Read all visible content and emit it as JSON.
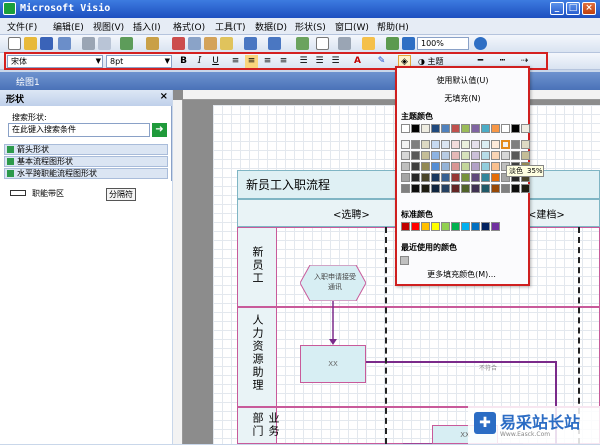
{
  "window": {
    "title": "Microsoft Visio"
  },
  "menu": [
    "文件(F)",
    "编辑(E)",
    "视图(V)",
    "插入(I)",
    "格式(O)",
    "工具(T)",
    "数据(D)",
    "形状(S)",
    "窗口(W)",
    "帮助(H)"
  ],
  "toolbar": {
    "zoom": "100%"
  },
  "format_bar": {
    "font": "宋体",
    "size": "8pt",
    "bold": "B",
    "italic": "I",
    "underline": "U",
    "theme_label": "主题"
  },
  "document": {
    "tab_title": "绘图1"
  },
  "shapes_pane": {
    "title": "形状",
    "search_label": "搜索形状:",
    "search_placeholder": "在此键入搜索条件",
    "stencils": [
      "箭头形状",
      "基本流程图形状",
      "水平跨职能流程图形状"
    ],
    "shape_lane": "职能带区",
    "shape_separator": "分隔符"
  },
  "diagram": {
    "pool_title": "新员工入职流程",
    "phases": [
      "<选聘>",
      "<建档>"
    ],
    "lanes": [
      "新员工",
      "人力资源助理",
      "业务部门"
    ],
    "hex_text": "入职申请接受通讯",
    "process_label": "XX",
    "uncertain_label": "不符合"
  },
  "fill_menu": {
    "use_default": "使用默认值(U)",
    "no_fill": "无填充(N)",
    "theme_colors_label": "主题颜色",
    "standard_colors_label": "标准颜色",
    "recent_colors_label": "最近使用的颜色",
    "more_colors": "更多填充颜色(M)...",
    "tooltip": "淡色",
    "tooltip_pct": "35%"
  },
  "theme_top_row": [
    "#ffffff",
    "#000000",
    "#eeece1",
    "#1f497d",
    "#4f81bd",
    "#c0504d",
    "#9bbb59",
    "#8064a2",
    "#4bacc6",
    "#f79646",
    "#ffffff",
    "#000000",
    "#eeece1"
  ],
  "theme_grid": [
    [
      "#f2f2f2",
      "#7f7f7f",
      "#ddd9c3",
      "#c6d9f0",
      "#dbe5f1",
      "#f2dcdb",
      "#ebf1dd",
      "#e5e0ec",
      "#dbeef3",
      "#fdeada",
      "#f2f2f2",
      "#7f7f7f",
      "#ddd9c3"
    ],
    [
      "#d8d8d8",
      "#595959",
      "#c4bd97",
      "#8db3e2",
      "#b8cce4",
      "#e5b9b7",
      "#d7e3bc",
      "#ccc1d9",
      "#b7dde8",
      "#fbd5b5",
      "#d8d8d8",
      "#595959",
      "#c4bd97"
    ],
    [
      "#bfbfbf",
      "#3f3f3f",
      "#938953",
      "#548dd4",
      "#95b3d7",
      "#d99694",
      "#c3d69b",
      "#b2a2c7",
      "#92cddc",
      "#fac08f",
      "#bfbfbf",
      "#3f3f3f",
      "#938953"
    ],
    [
      "#a5a5a5",
      "#262626",
      "#494429",
      "#17365d",
      "#366092",
      "#953734",
      "#76923c",
      "#5f497a",
      "#31859b",
      "#e36c09",
      "#a5a5a5",
      "#262626",
      "#494429"
    ],
    [
      "#7f7f7f",
      "#0c0c0c",
      "#1d1b10",
      "#0f243e",
      "#244061",
      "#632423",
      "#4f6128",
      "#3f3151",
      "#205867",
      "#974806",
      "#7f7f7f",
      "#0c0c0c",
      "#1d1b10"
    ]
  ],
  "standard_colors": [
    "#c00000",
    "#ff0000",
    "#ffc000",
    "#ffff00",
    "#92d050",
    "#00b050",
    "#00b0f0",
    "#0070c0",
    "#002060",
    "#7030a0"
  ],
  "watermark": {
    "text": "易采站长站",
    "sub": "Www.Easck.Com"
  }
}
